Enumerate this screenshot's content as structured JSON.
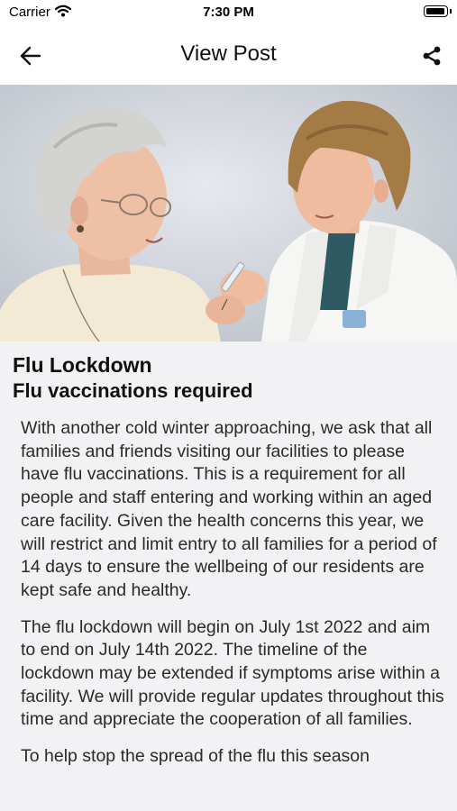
{
  "status": {
    "carrier": "Carrier",
    "time": "7:30 PM",
    "battery_level": 0.95
  },
  "nav": {
    "title": "View Post",
    "back_icon": "arrow-left-icon",
    "share_icon": "share-icon"
  },
  "post": {
    "title": "Flu Lockdown",
    "subtitle": "Flu vaccinations required",
    "paragraphs": [
      "With another cold winter approaching, we ask that all families and friends visiting our facilities to please have flu vaccinations. This is a requirement for all people and staff entering and working within an aged care facility. Given the health concerns this year, we will restrict and limit entry to all families for a period of 14 days to ensure the wellbeing of our residents are kept safe and healthy.",
      "The flu lockdown will begin on July 1st 2022 and aim to end on July 14th 2022. The timeline of the lockdown may be extended if symptoms arise within a facility. We will provide regular updates throughout this time and appreciate the cooperation of all families.",
      "To help stop the spread of the flu this season"
    ]
  },
  "colors": {
    "content_background": "#f2f2f4",
    "text": "#1c1c1e"
  }
}
